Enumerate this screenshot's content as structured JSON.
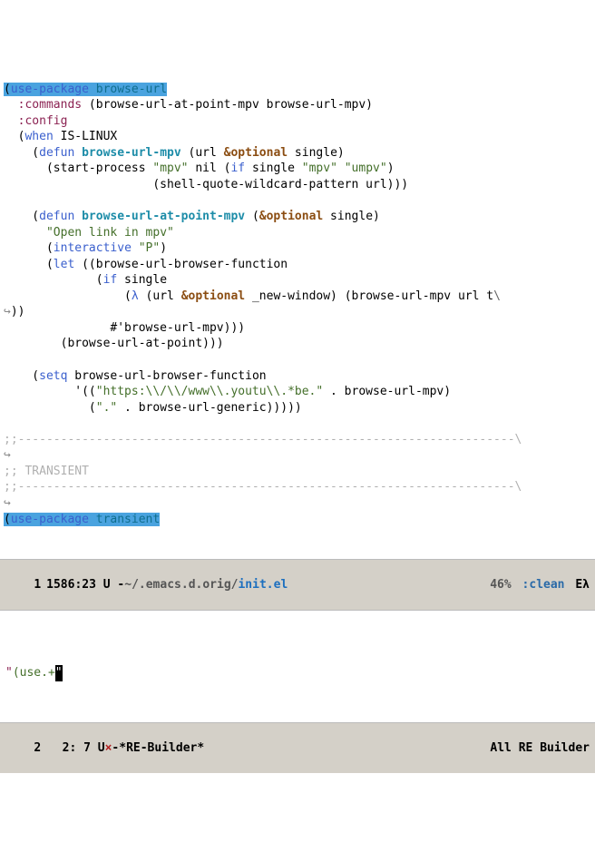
{
  "code": {
    "l1a": "(",
    "l1b": "use-package",
    "l1c": " ",
    "l1d": "browse-url",
    "l2a": "  ",
    "l2b": ":commands",
    "l2c": " (browse-url-at-point-mpv browse-url-mpv)",
    "l3a": "  ",
    "l3b": ":config",
    "l4a": "  (",
    "l4b": "when",
    "l4c": " IS-LINUX",
    "l5a": "    (",
    "l5b": "defun",
    "l5c": " ",
    "l5d": "browse-url-mpv",
    "l5e": " (url ",
    "l5f": "&optional",
    "l5g": " single)",
    "l6a": "      (start-process ",
    "l6b": "\"mpv\"",
    "l6c": " nil (",
    "l6d": "if",
    "l6e": " single ",
    "l6f": "\"mpv\"",
    "l6g": " ",
    "l6h": "\"umpv\"",
    "l6i": ")",
    "l7a": "                     (shell-quote-wildcard-pattern url)))",
    "l9a": "    (",
    "l9b": "defun",
    "l9c": " ",
    "l9d": "browse-url-at-point-mpv",
    "l9e": " (",
    "l9f": "&optional",
    "l9g": " single)",
    "l10a": "      ",
    "l10b": "\"Open link in mpv\"",
    "l11a": "      (",
    "l11b": "interactive",
    "l11c": " ",
    "l11d": "\"P\"",
    "l11e": ")",
    "l12a": "      (",
    "l12b": "let",
    "l12c": " ((browse-url-browser-function",
    "l13a": "             (",
    "l13b": "if",
    "l13c": " single",
    "l14a": "                 (",
    "l14b": "λ",
    "l14c": " (url ",
    "l14d": "&optional",
    "l14e": " _new-window) (browse-url-mpv url t",
    "l14f": "\\",
    "l15a": "))",
    "l15pre": "↪",
    "l16a": "               #'browse-url-mpv)))",
    "l17a": "        (browse-url-at-point)))",
    "l19a": "    (",
    "l19b": "setq",
    "l19c": " browse-url-browser-function",
    "l20a": "          '((",
    "l20b": "\"https:\\\\/\\\\/www\\\\.youtu\\\\.*be.\"",
    "l20c": " . browse-url-mpv)",
    "l21a": "            (",
    "l21b": "\".\"",
    "l21c": " . browse-url-generic)))))",
    "c1": ";;----------------------------------------------------------------------\\",
    "c2": ";; TRANSIENT",
    "c3": ";;----------------------------------------------------------------------\\",
    "t1a": "(",
    "t1b": "use-package",
    "t1c": " ",
    "t1d": "transient"
  },
  "modeline1": {
    "win": "1",
    "pos": "1586:23",
    "flags": "U -",
    "path": "~/.emacs.d.orig/",
    "file": "init.el",
    "pct": "46%",
    "colon": ":",
    "clean": "clean",
    "tail": "Eλ"
  },
  "minibuf": {
    "open": "\"",
    "text": "(use.+",
    "close": "\""
  },
  "modeline2": {
    "win": "2",
    "pos": "2: 7",
    "u": "U",
    "x": "×",
    "dash": "-",
    "buf": "*RE-Builder*",
    "all": "All",
    "mode": "RE Builder"
  }
}
